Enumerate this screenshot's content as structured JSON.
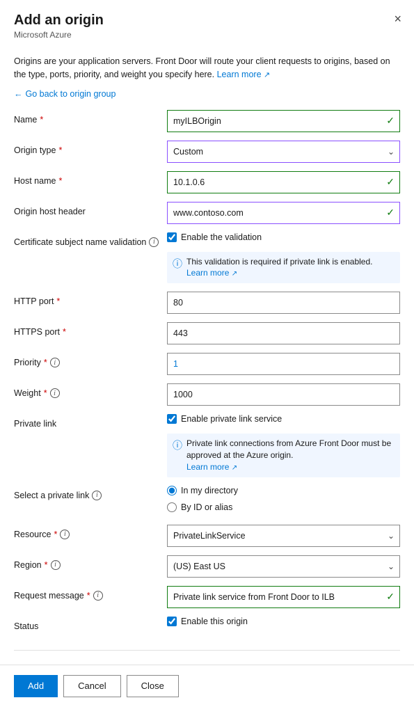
{
  "header": {
    "title": "Add an origin",
    "subtitle": "Microsoft Azure",
    "close_label": "×"
  },
  "description": {
    "text": "Origins are your application servers. Front Door will route your client requests to origins, based on the type, ports, priority, and weight you specify here.",
    "learn_more": "Learn more",
    "learn_more_url": "#"
  },
  "back_link": "Go back to origin group",
  "form": {
    "name_label": "Name",
    "name_value": "myILBOrigin",
    "origin_type_label": "Origin type",
    "origin_type_value": "Custom",
    "host_name_label": "Host name",
    "host_name_value": "10.1.0.6",
    "origin_host_header_label": "Origin host header",
    "origin_host_header_value": "www.contoso.com",
    "cert_validation_label": "Certificate subject name validation",
    "cert_validation_checkbox": "Enable the validation",
    "cert_validation_info": "This validation is required if private link is enabled.",
    "cert_learn_more": "Learn more",
    "http_port_label": "HTTP port",
    "http_port_value": "80",
    "https_port_label": "HTTPS port",
    "https_port_value": "443",
    "priority_label": "Priority",
    "priority_value": "1",
    "weight_label": "Weight",
    "weight_value": "1000",
    "private_link_label": "Private link",
    "private_link_checkbox": "Enable private link service",
    "private_link_info": "Private link connections from Azure Front Door must be approved at the Azure origin.",
    "private_link_learn_more": "Learn more",
    "select_private_link_label": "Select a private link",
    "radio_in_my_directory": "In my directory",
    "radio_by_id": "By ID or alias",
    "resource_label": "Resource",
    "resource_value": "PrivateLinkService",
    "region_label": "Region",
    "region_value": "(US) East US",
    "request_message_label": "Request message",
    "request_message_value": "Private link service from Front Door to ILB",
    "status_label": "Status",
    "status_checkbox": "Enable this origin"
  },
  "footer": {
    "add_label": "Add",
    "cancel_label": "Cancel",
    "close_label": "Close"
  }
}
